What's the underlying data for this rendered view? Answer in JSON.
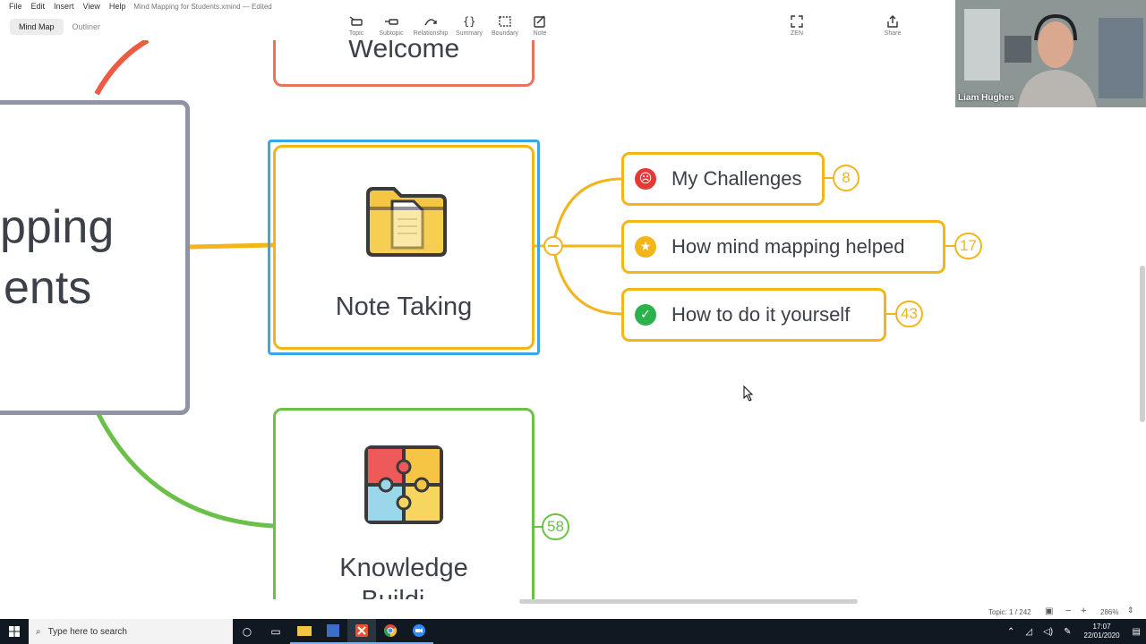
{
  "menu": {
    "items": [
      "File",
      "Edit",
      "Insert",
      "View",
      "Help"
    ],
    "document_title": "Mind Mapping for Students.xmind",
    "edit_status": "— Edited"
  },
  "view_toggle": {
    "mind_map": "Mind Map",
    "outliner": "Outliner"
  },
  "toolbar": {
    "topic": "Topic",
    "subtopic": "Subtopic",
    "relationship": "Relationship",
    "summary": "Summary",
    "boundary": "Boundary",
    "note": "Note",
    "zen": "ZEN",
    "share": "Share"
  },
  "mindmap": {
    "central_lines": [
      "pping",
      "ents"
    ],
    "welcome": "Welcome",
    "note_taking": "Note Taking",
    "knowledge_building": [
      "Knowledge",
      "Buildi..."
    ],
    "knowledge_count": "58",
    "subtopics": [
      {
        "label": "My Challenges",
        "count": "8",
        "icon": "angry-face-icon",
        "icon_color": "#e53935"
      },
      {
        "label": "How mind mapping helped",
        "count": "17",
        "icon": "star-icon",
        "icon_color": "#f2b51a"
      },
      {
        "label": "How to do it yourself",
        "count": "43",
        "icon": "check-icon",
        "icon_color": "#2bb24c"
      }
    ]
  },
  "colors": {
    "orange_branch": "#f2b51a",
    "red_branch": "#e9735f",
    "green_branch": "#6cc04a",
    "focus_border": "#39a6e6",
    "central_border": "#8e93a6"
  },
  "statusbar": {
    "topic_count": "Topic: 1 / 242",
    "zoom": "286%"
  },
  "webcam": {
    "name": "Liam Hughes"
  },
  "taskbar": {
    "search_placeholder": "Type here to search",
    "time": "17:07",
    "date": "22/01/2020"
  }
}
